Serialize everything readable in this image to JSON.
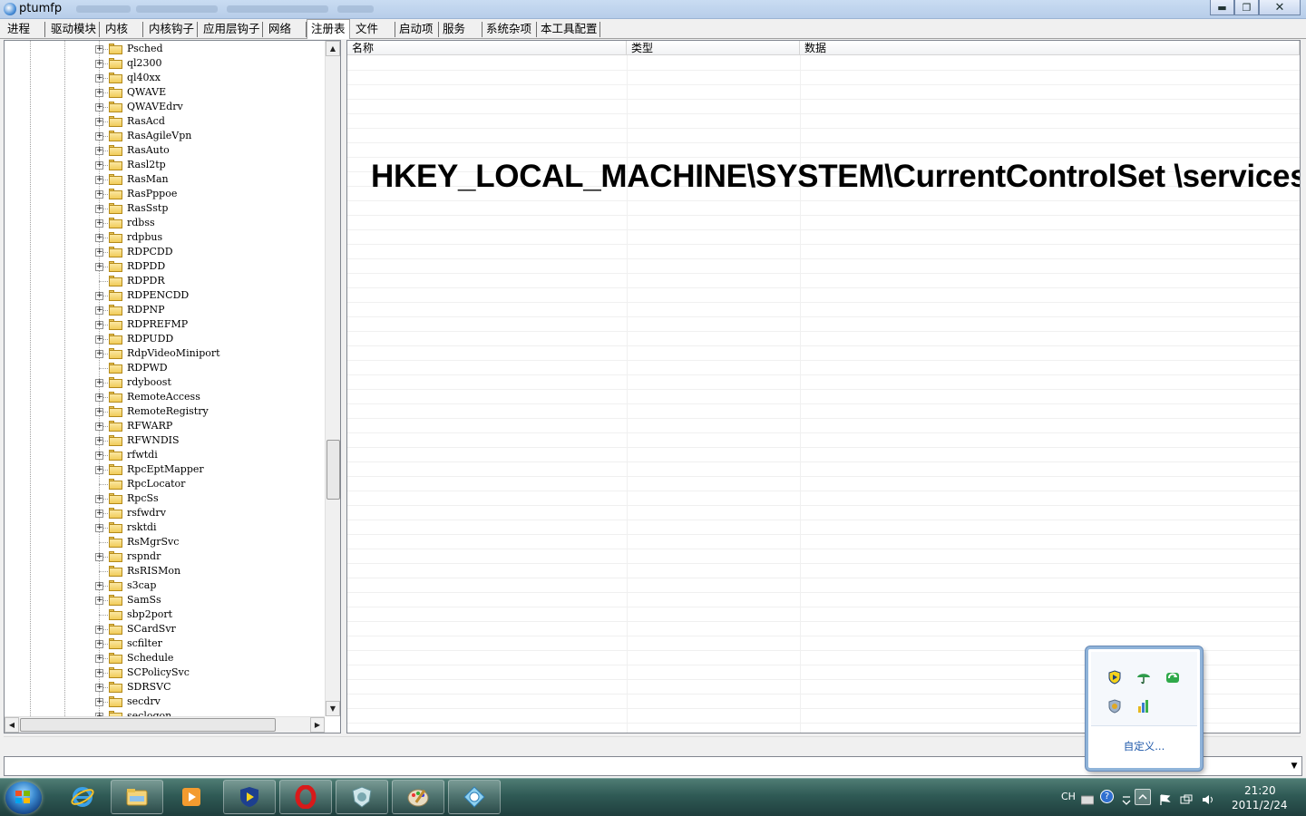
{
  "window": {
    "title": "ptumfp",
    "minimize_glyph": "▬",
    "maximize_glyph": "❐",
    "close_glyph": "✕"
  },
  "tabs": [
    {
      "label": "进程"
    },
    {
      "label": "驱动模块"
    },
    {
      "label": "内核"
    },
    {
      "label": "内核钩子"
    },
    {
      "label": "应用层钩子"
    },
    {
      "label": "网络"
    },
    {
      "label": "注册表",
      "active": true
    },
    {
      "label": "文件"
    },
    {
      "label": "启动项"
    },
    {
      "label": "服务"
    },
    {
      "label": "系统杂项"
    },
    {
      "label": "本工具配置"
    }
  ],
  "tree": {
    "items": [
      {
        "label": "Psched",
        "expandable": true
      },
      {
        "label": "ql2300",
        "expandable": true
      },
      {
        "label": "ql40xx",
        "expandable": true
      },
      {
        "label": "QWAVE",
        "expandable": true
      },
      {
        "label": "QWAVEdrv",
        "expandable": true
      },
      {
        "label": "RasAcd",
        "expandable": true
      },
      {
        "label": "RasAgileVpn",
        "expandable": true
      },
      {
        "label": "RasAuto",
        "expandable": true
      },
      {
        "label": "Rasl2tp",
        "expandable": true
      },
      {
        "label": "RasMan",
        "expandable": true
      },
      {
        "label": "RasPppoe",
        "expandable": true
      },
      {
        "label": "RasSstp",
        "expandable": true
      },
      {
        "label": "rdbss",
        "expandable": true
      },
      {
        "label": "rdpbus",
        "expandable": true
      },
      {
        "label": "RDPCDD",
        "expandable": true
      },
      {
        "label": "RDPDD",
        "expandable": true
      },
      {
        "label": "RDPDR",
        "expandable": false
      },
      {
        "label": "RDPENCDD",
        "expandable": true
      },
      {
        "label": "RDPNP",
        "expandable": true
      },
      {
        "label": "RDPREFMP",
        "expandable": true
      },
      {
        "label": "RDPUDD",
        "expandable": true
      },
      {
        "label": "RdpVideoMiniport",
        "expandable": true
      },
      {
        "label": "RDPWD",
        "expandable": false
      },
      {
        "label": "rdyboost",
        "expandable": true
      },
      {
        "label": "RemoteAccess",
        "expandable": true
      },
      {
        "label": "RemoteRegistry",
        "expandable": true
      },
      {
        "label": "RFWARP",
        "expandable": true
      },
      {
        "label": "RFWNDIS",
        "expandable": true
      },
      {
        "label": "rfwtdi",
        "expandable": true
      },
      {
        "label": "RpcEptMapper",
        "expandable": true
      },
      {
        "label": "RpcLocator",
        "expandable": false
      },
      {
        "label": "RpcSs",
        "expandable": true
      },
      {
        "label": "rsfwdrv",
        "expandable": true
      },
      {
        "label": "rsktdi",
        "expandable": true
      },
      {
        "label": "RsMgrSvc",
        "expandable": false
      },
      {
        "label": "rspndr",
        "expandable": true
      },
      {
        "label": "RsRISMon",
        "expandable": false
      },
      {
        "label": "s3cap",
        "expandable": true
      },
      {
        "label": "SamSs",
        "expandable": true
      },
      {
        "label": "sbp2port",
        "expandable": false
      },
      {
        "label": "SCardSvr",
        "expandable": true
      },
      {
        "label": "scfilter",
        "expandable": true
      },
      {
        "label": "Schedule",
        "expandable": true
      },
      {
        "label": "SCPolicySvc",
        "expandable": true
      },
      {
        "label": "SDRSVC",
        "expandable": true
      },
      {
        "label": "secdrv",
        "expandable": true
      },
      {
        "label": "seclogon",
        "expandable": true
      }
    ],
    "expander_glyph": "+",
    "scroll_up_glyph": "▲",
    "scroll_down_glyph": "▼",
    "scroll_left_glyph": "◀",
    "scroll_right_glyph": "▶"
  },
  "list": {
    "columns": [
      "名称",
      "类型",
      "数据"
    ],
    "overlay_path": "HKEY_LOCAL_MACHINE\\SYSTEM\\CurrentControlSet \\services"
  },
  "bottom_combo": {
    "arrow_glyph": "▼"
  },
  "tray_popup": {
    "customize_link": "自定义...",
    "icons": [
      "shield-yellow-icon",
      "umbrella-icon",
      "green-refresh-icon",
      "shield-badge-icon",
      "bar-chart-icon"
    ]
  },
  "taskbar": {
    "buttons": [
      "start-button",
      "ie-icon",
      "explorer-icon",
      "media-player-icon",
      "shield-app-icon",
      "opera-icon",
      "bug-app-icon",
      "paint-icon",
      "ptumfp-app-icon"
    ],
    "lang": "CH",
    "time": "21:20",
    "date": "2011/2/24",
    "help_glyph": "?"
  },
  "colors": {
    "title_bar": "#c9dcf2",
    "taskbar": "#2f5a55",
    "link": "#1a55a8"
  }
}
